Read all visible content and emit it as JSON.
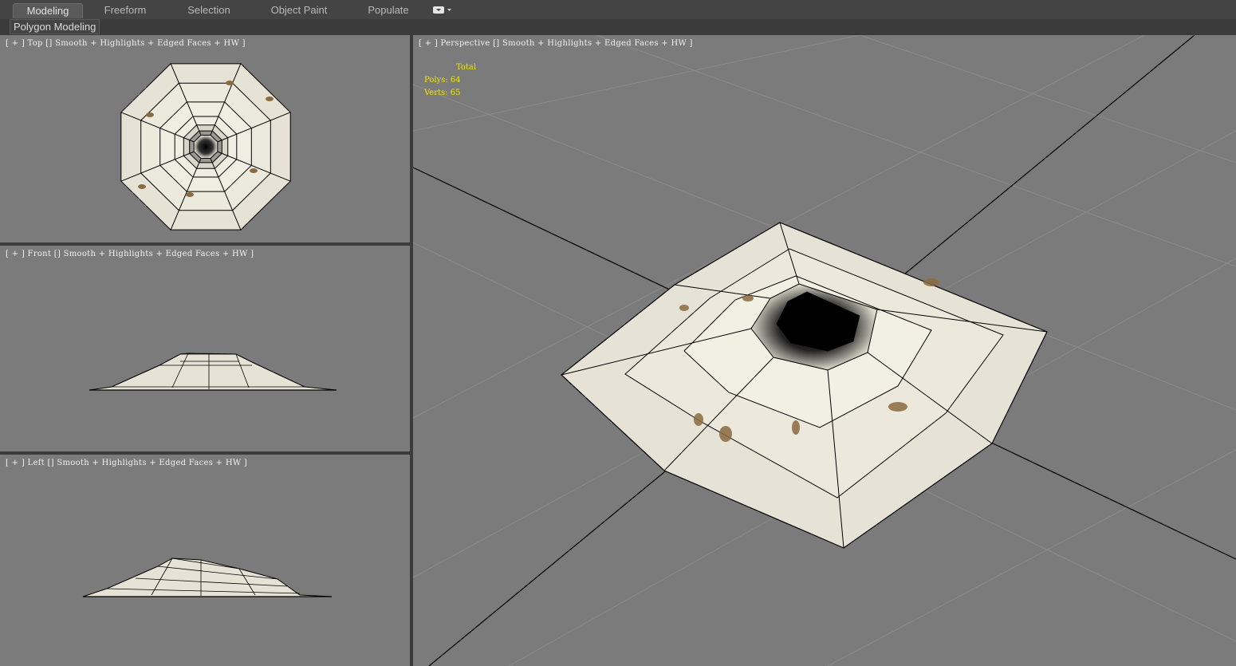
{
  "ribbon": {
    "tabs": [
      {
        "label": "Modeling",
        "active": true
      },
      {
        "label": "Freeform",
        "active": false
      },
      {
        "label": "Selection",
        "active": false
      },
      {
        "label": "Object Paint",
        "active": false
      },
      {
        "label": "Populate",
        "active": false
      }
    ],
    "dropdown_icon": "ribbon-options-icon",
    "panel_label": "Polygon Modeling"
  },
  "viewports": {
    "top": {
      "label": "[ + ] Top [] Smooth + Highlights + Edged Faces + HW ]"
    },
    "front": {
      "label": "[ + ] Front [] Smooth + Highlights + Edged Faces + HW ]"
    },
    "left": {
      "label": "[ + ] Left [] Smooth + Highlights + Edged Faces + HW ]"
    },
    "perspective": {
      "label": "[ + ] Perspective [] Smooth + Highlights + Edged Faces + HW ]"
    }
  },
  "stats": {
    "header": "Total",
    "polys_label": "Polys:",
    "polys_value": "64",
    "verts_label": "Verts:",
    "verts_value": "65"
  },
  "colors": {
    "viewport_bg": "#7b7b7b",
    "stats_text": "#f3e300",
    "wire": "#000000",
    "texture": "#e8e6d8"
  }
}
